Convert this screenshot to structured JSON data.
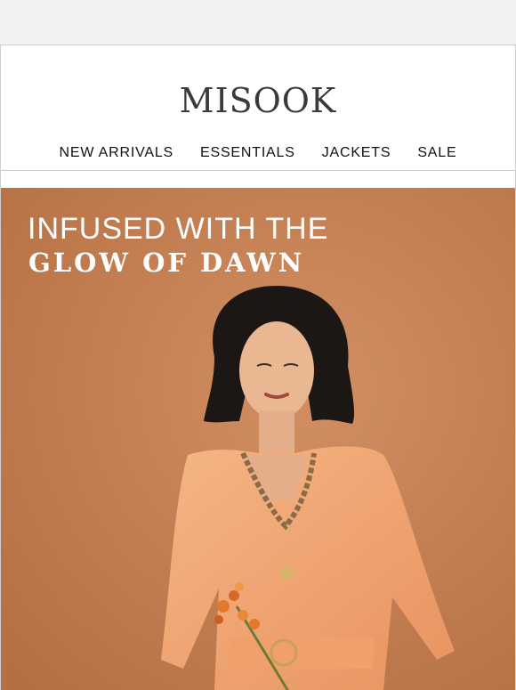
{
  "brand": {
    "logo_text": "MISOOK"
  },
  "nav": {
    "items": [
      "NEW ARRIVALS",
      "ESSENTIALS",
      "JACKETS",
      "SALE"
    ]
  },
  "hero": {
    "headline_line1": "INFUSED WITH THE",
    "headline_line2": "GLOW OF DAWN",
    "image_label": "woman-in-peach-dress-photo"
  },
  "colors": {
    "hero_background": "#c27d50",
    "dress": "#f2a774",
    "text_on_hero": "#ffffff"
  }
}
